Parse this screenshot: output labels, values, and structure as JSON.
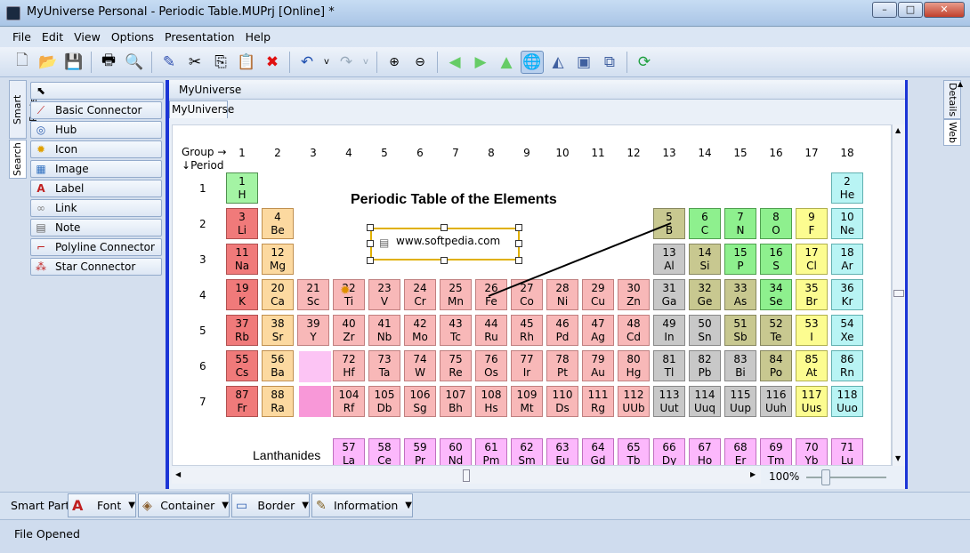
{
  "window": {
    "title": "MyUniverse Personal - Periodic Table.MUPrj [Online] *",
    "min": "–",
    "max": "□",
    "close": "✕"
  },
  "menu": [
    "File",
    "Edit",
    "View",
    "Options",
    "Presentation",
    "Help"
  ],
  "toolbar": {
    "icons": [
      "new-icon",
      "open-icon",
      "save-icon",
      "print-icon",
      "print-preview-icon",
      "pen-icon",
      "cut-icon",
      "copy-icon",
      "paste-icon",
      "delete-icon",
      "undo-icon",
      "undo-dropdown-icon",
      "redo-icon",
      "redo-dropdown-icon",
      "zoom-in-icon",
      "zoom-out-icon",
      "back-icon",
      "forward-icon",
      "home-icon",
      "globe-icon",
      "mirror-icon",
      "fit-icon",
      "layout-icon",
      "refresh-icon"
    ]
  },
  "left_tabs": {
    "smart_parts": "Smart Parts",
    "search": "Search"
  },
  "palette": [
    {
      "label": "Basic Connector",
      "icon": "connector-icon"
    },
    {
      "label": "Hub",
      "icon": "hub-icon"
    },
    {
      "label": "Icon",
      "icon": "star-icon"
    },
    {
      "label": "Image",
      "icon": "image-icon"
    },
    {
      "label": "Label",
      "icon": "label-icon"
    },
    {
      "label": "Link",
      "icon": "link-icon"
    },
    {
      "label": "Note",
      "icon": "note-icon"
    },
    {
      "label": "Polyline Connector",
      "icon": "polyline-icon"
    },
    {
      "label": "Star Connector",
      "icon": "star-connector-icon"
    }
  ],
  "doc": {
    "header": "MyUniverse",
    "tab": "MyUniverse",
    "zoom": "100%"
  },
  "canvas": {
    "group_label": "Group",
    "period_label": "Period",
    "title": "Periodic Table of the Elements",
    "note_text": "www.softpedia.com",
    "lanthanides_label": "Lanthanides",
    "groups": [
      "1",
      "2",
      "3",
      "4",
      "5",
      "6",
      "7",
      "8",
      "9",
      "10",
      "11",
      "12",
      "13",
      "14",
      "15",
      "16",
      "17",
      "18"
    ],
    "periods": [
      "1",
      "2",
      "3",
      "4",
      "5",
      "6",
      "7"
    ]
  },
  "elements": [
    {
      "n": "1",
      "s": "H",
      "c": "h",
      "g": 1,
      "p": 1
    },
    {
      "n": "2",
      "s": "He",
      "c": "ng",
      "g": 18,
      "p": 1
    },
    {
      "n": "3",
      "s": "Li",
      "c": "alk",
      "g": 1,
      "p": 2
    },
    {
      "n": "4",
      "s": "Be",
      "c": "ear",
      "g": 2,
      "p": 2
    },
    {
      "n": "5",
      "s": "B",
      "c": "sm",
      "g": 13,
      "p": 2
    },
    {
      "n": "6",
      "s": "C",
      "c": "nm",
      "g": 14,
      "p": 2
    },
    {
      "n": "7",
      "s": "N",
      "c": "nm",
      "g": 15,
      "p": 2
    },
    {
      "n": "8",
      "s": "O",
      "c": "nm",
      "g": 16,
      "p": 2
    },
    {
      "n": "9",
      "s": "F",
      "c": "hal",
      "g": 17,
      "p": 2
    },
    {
      "n": "10",
      "s": "Ne",
      "c": "ng",
      "g": 18,
      "p": 2
    },
    {
      "n": "11",
      "s": "Na",
      "c": "alk",
      "g": 1,
      "p": 3
    },
    {
      "n": "12",
      "s": "Mg",
      "c": "ear",
      "g": 2,
      "p": 3
    },
    {
      "n": "13",
      "s": "Al",
      "c": "met",
      "g": 13,
      "p": 3
    },
    {
      "n": "14",
      "s": "Si",
      "c": "sm",
      "g": 14,
      "p": 3
    },
    {
      "n": "15",
      "s": "P",
      "c": "nm",
      "g": 15,
      "p": 3
    },
    {
      "n": "16",
      "s": "S",
      "c": "nm",
      "g": 16,
      "p": 3
    },
    {
      "n": "17",
      "s": "Cl",
      "c": "hal",
      "g": 17,
      "p": 3
    },
    {
      "n": "18",
      "s": "Ar",
      "c": "ng",
      "g": 18,
      "p": 3
    },
    {
      "n": "19",
      "s": "K",
      "c": "alk",
      "g": 1,
      "p": 4
    },
    {
      "n": "20",
      "s": "Ca",
      "c": "ear",
      "g": 2,
      "p": 4
    },
    {
      "n": "21",
      "s": "Sc",
      "c": "tr",
      "g": 3,
      "p": 4
    },
    {
      "n": "22",
      "s": "Ti",
      "c": "tr",
      "g": 4,
      "p": 4
    },
    {
      "n": "23",
      "s": "V",
      "c": "tr",
      "g": 5,
      "p": 4
    },
    {
      "n": "24",
      "s": "Cr",
      "c": "tr",
      "g": 6,
      "p": 4
    },
    {
      "n": "25",
      "s": "Mn",
      "c": "tr",
      "g": 7,
      "p": 4
    },
    {
      "n": "26",
      "s": "Fe",
      "c": "tr",
      "g": 8,
      "p": 4
    },
    {
      "n": "27",
      "s": "Co",
      "c": "tr",
      "g": 9,
      "p": 4
    },
    {
      "n": "28",
      "s": "Ni",
      "c": "tr",
      "g": 10,
      "p": 4
    },
    {
      "n": "29",
      "s": "Cu",
      "c": "tr",
      "g": 11,
      "p": 4
    },
    {
      "n": "30",
      "s": "Zn",
      "c": "tr",
      "g": 12,
      "p": 4
    },
    {
      "n": "31",
      "s": "Ga",
      "c": "met",
      "g": 13,
      "p": 4
    },
    {
      "n": "32",
      "s": "Ge",
      "c": "sm",
      "g": 14,
      "p": 4
    },
    {
      "n": "33",
      "s": "As",
      "c": "sm",
      "g": 15,
      "p": 4
    },
    {
      "n": "34",
      "s": "Se",
      "c": "nm",
      "g": 16,
      "p": 4
    },
    {
      "n": "35",
      "s": "Br",
      "c": "hal",
      "g": 17,
      "p": 4
    },
    {
      "n": "36",
      "s": "Kr",
      "c": "ng",
      "g": 18,
      "p": 4
    },
    {
      "n": "37",
      "s": "Rb",
      "c": "alk",
      "g": 1,
      "p": 5
    },
    {
      "n": "38",
      "s": "Sr",
      "c": "ear",
      "g": 2,
      "p": 5
    },
    {
      "n": "39",
      "s": "Y",
      "c": "tr",
      "g": 3,
      "p": 5
    },
    {
      "n": "40",
      "s": "Zr",
      "c": "tr",
      "g": 4,
      "p": 5
    },
    {
      "n": "41",
      "s": "Nb",
      "c": "tr",
      "g": 5,
      "p": 5
    },
    {
      "n": "42",
      "s": "Mo",
      "c": "tr",
      "g": 6,
      "p": 5
    },
    {
      "n": "43",
      "s": "Tc",
      "c": "tr",
      "g": 7,
      "p": 5
    },
    {
      "n": "44",
      "s": "Ru",
      "c": "tr",
      "g": 8,
      "p": 5
    },
    {
      "n": "45",
      "s": "Rh",
      "c": "tr",
      "g": 9,
      "p": 5
    },
    {
      "n": "46",
      "s": "Pd",
      "c": "tr",
      "g": 10,
      "p": 5
    },
    {
      "n": "47",
      "s": "Ag",
      "c": "tr",
      "g": 11,
      "p": 5
    },
    {
      "n": "48",
      "s": "Cd",
      "c": "tr",
      "g": 12,
      "p": 5
    },
    {
      "n": "49",
      "s": "In",
      "c": "met",
      "g": 13,
      "p": 5
    },
    {
      "n": "50",
      "s": "Sn",
      "c": "met",
      "g": 14,
      "p": 5
    },
    {
      "n": "51",
      "s": "Sb",
      "c": "sm",
      "g": 15,
      "p": 5
    },
    {
      "n": "52",
      "s": "Te",
      "c": "sm",
      "g": 16,
      "p": 5
    },
    {
      "n": "53",
      "s": "I",
      "c": "hal",
      "g": 17,
      "p": 5
    },
    {
      "n": "54",
      "s": "Xe",
      "c": "ng",
      "g": 18,
      "p": 5
    },
    {
      "n": "55",
      "s": "Cs",
      "c": "alk",
      "g": 1,
      "p": 6
    },
    {
      "n": "56",
      "s": "Ba",
      "c": "ear",
      "g": 2,
      "p": 6
    },
    {
      "n": "72",
      "s": "Hf",
      "c": "tr",
      "g": 4,
      "p": 6
    },
    {
      "n": "73",
      "s": "Ta",
      "c": "tr",
      "g": 5,
      "p": 6
    },
    {
      "n": "74",
      "s": "W",
      "c": "tr",
      "g": 6,
      "p": 6
    },
    {
      "n": "75",
      "s": "Re",
      "c": "tr",
      "g": 7,
      "p": 6
    },
    {
      "n": "76",
      "s": "Os",
      "c": "tr",
      "g": 8,
      "p": 6
    },
    {
      "n": "77",
      "s": "Ir",
      "c": "tr",
      "g": 9,
      "p": 6
    },
    {
      "n": "78",
      "s": "Pt",
      "c": "tr",
      "g": 10,
      "p": 6
    },
    {
      "n": "79",
      "s": "Au",
      "c": "tr",
      "g": 11,
      "p": 6
    },
    {
      "n": "80",
      "s": "Hg",
      "c": "tr",
      "g": 12,
      "p": 6
    },
    {
      "n": "81",
      "s": "Tl",
      "c": "met",
      "g": 13,
      "p": 6
    },
    {
      "n": "82",
      "s": "Pb",
      "c": "met",
      "g": 14,
      "p": 6
    },
    {
      "n": "83",
      "s": "Bi",
      "c": "met",
      "g": 15,
      "p": 6
    },
    {
      "n": "84",
      "s": "Po",
      "c": "sm",
      "g": 16,
      "p": 6
    },
    {
      "n": "85",
      "s": "At",
      "c": "hal",
      "g": 17,
      "p": 6
    },
    {
      "n": "86",
      "s": "Rn",
      "c": "ng",
      "g": 18,
      "p": 6
    },
    {
      "n": "87",
      "s": "Fr",
      "c": "alk",
      "g": 1,
      "p": 7
    },
    {
      "n": "88",
      "s": "Ra",
      "c": "ear",
      "g": 2,
      "p": 7
    },
    {
      "n": "104",
      "s": "Rf",
      "c": "tr",
      "g": 4,
      "p": 7
    },
    {
      "n": "105",
      "s": "Db",
      "c": "tr",
      "g": 5,
      "p": 7
    },
    {
      "n": "106",
      "s": "Sg",
      "c": "tr",
      "g": 6,
      "p": 7
    },
    {
      "n": "107",
      "s": "Bh",
      "c": "tr",
      "g": 7,
      "p": 7
    },
    {
      "n": "108",
      "s": "Hs",
      "c": "tr",
      "g": 8,
      "p": 7
    },
    {
      "n": "109",
      "s": "Mt",
      "c": "tr",
      "g": 9,
      "p": 7
    },
    {
      "n": "110",
      "s": "Ds",
      "c": "tr",
      "g": 10,
      "p": 7
    },
    {
      "n": "111",
      "s": "Rg",
      "c": "tr",
      "g": 11,
      "p": 7
    },
    {
      "n": "112",
      "s": "UUb",
      "c": "tr",
      "g": 12,
      "p": 7
    },
    {
      "n": "113",
      "s": "Uut",
      "c": "met",
      "g": 13,
      "p": 7
    },
    {
      "n": "114",
      "s": "Uuq",
      "c": "met",
      "g": 14,
      "p": 7
    },
    {
      "n": "115",
      "s": "Uup",
      "c": "met",
      "g": 15,
      "p": 7
    },
    {
      "n": "116",
      "s": "Uuh",
      "c": "met",
      "g": 16,
      "p": 7
    },
    {
      "n": "117",
      "s": "Uus",
      "c": "hal",
      "g": 17,
      "p": 7
    },
    {
      "n": "118",
      "s": "Uuo",
      "c": "ng",
      "g": 18,
      "p": 7
    },
    {
      "n": "57",
      "s": "La",
      "c": "la",
      "g": 4,
      "p": 8
    },
    {
      "n": "58",
      "s": "Ce",
      "c": "la",
      "g": 5,
      "p": 8
    },
    {
      "n": "59",
      "s": "Pr",
      "c": "la",
      "g": 6,
      "p": 8
    },
    {
      "n": "60",
      "s": "Nd",
      "c": "la",
      "g": 7,
      "p": 8
    },
    {
      "n": "61",
      "s": "Pm",
      "c": "la",
      "g": 8,
      "p": 8
    },
    {
      "n": "62",
      "s": "Sm",
      "c": "la",
      "g": 9,
      "p": 8
    },
    {
      "n": "63",
      "s": "Eu",
      "c": "la",
      "g": 10,
      "p": 8
    },
    {
      "n": "64",
      "s": "Gd",
      "c": "la",
      "g": 11,
      "p": 8
    },
    {
      "n": "65",
      "s": "Tb",
      "c": "la",
      "g": 12,
      "p": 8
    },
    {
      "n": "66",
      "s": "Dy",
      "c": "la",
      "g": 13,
      "p": 8
    },
    {
      "n": "67",
      "s": "Ho",
      "c": "la",
      "g": 14,
      "p": 8
    },
    {
      "n": "68",
      "s": "Er",
      "c": "la",
      "g": 15,
      "p": 8
    },
    {
      "n": "69",
      "s": "Tm",
      "c": "la",
      "g": 16,
      "p": 8
    },
    {
      "n": "70",
      "s": "Yb",
      "c": "la",
      "g": 17,
      "p": 8
    },
    {
      "n": "71",
      "s": "Lu",
      "c": "la",
      "g": 18,
      "p": 8
    }
  ],
  "right_tabs": {
    "details": "Details",
    "web": "Web"
  },
  "smart_part_bar": {
    "label": "Smart Part:",
    "buttons": [
      "Font",
      "Container",
      "Border",
      "Information"
    ]
  },
  "status": {
    "text": "File Opened"
  }
}
